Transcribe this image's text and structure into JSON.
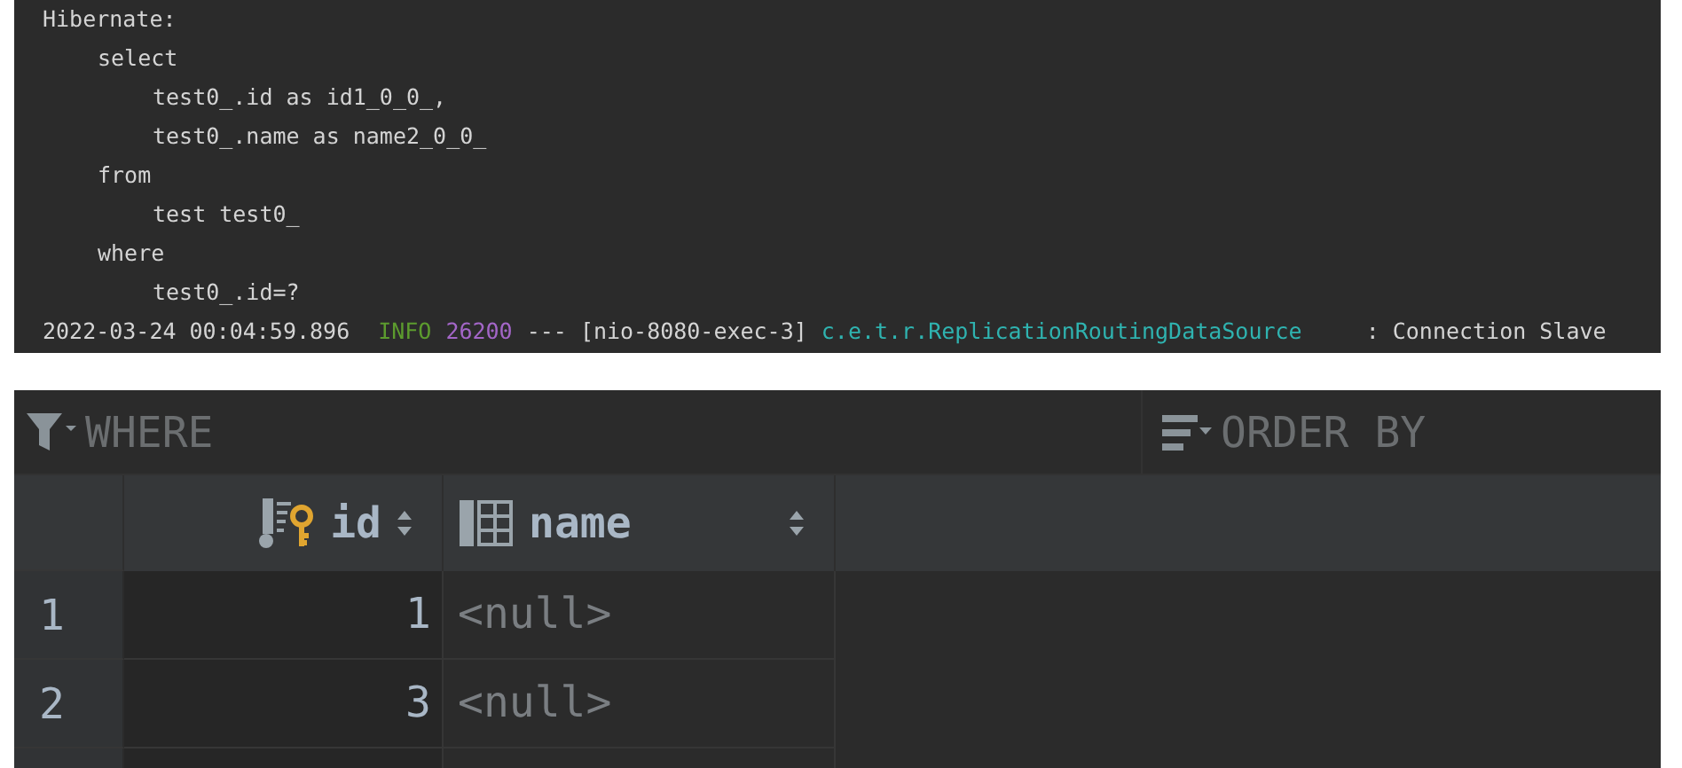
{
  "console": {
    "lines": [
      {
        "text": "Hibernate:",
        "children": [
          {
            "text": "select",
            "children": [
              {
                "text": "test0_.id as id1_0_0_,"
              },
              {
                "text": "test0_.name as name2_0_0_"
              }
            ]
          },
          {
            "text": "from",
            "children": [
              {
                "text": "test test0_"
              }
            ]
          },
          {
            "text": "where",
            "children": [
              {
                "text": "test0_.id=?"
              }
            ]
          }
        ]
      }
    ],
    "log_line": [
      {
        "kind": "timestamp",
        "text": "2022-03-24 00:04:59.896"
      },
      {
        "kind": "level",
        "text": "INFO"
      },
      {
        "kind": "pid",
        "text": "26200"
      },
      {
        "kind": "plain",
        "text": "--- [nio-8080-exec-3]"
      },
      {
        "kind": "logger",
        "text": "c.e.t.r.ReplicationRoutingDataSource"
      },
      {
        "kind": "plain",
        "text": ": Connection Slave"
      }
    ]
  },
  "data_grid": {
    "filter": {
      "placeholder": "WHERE"
    },
    "order": {
      "placeholder": "ORDER BY"
    },
    "columns": [
      {
        "name": "id",
        "kind": "primary_key"
      },
      {
        "name": "name",
        "kind": "column"
      }
    ],
    "rows": [
      {
        "number": "1",
        "cells": [
          {
            "text": "1",
            "kind": "number"
          },
          {
            "text": "<null>",
            "kind": "null"
          }
        ]
      },
      {
        "number": "2",
        "cells": [
          {
            "text": "3",
            "kind": "number"
          },
          {
            "text": "<null>",
            "kind": "null"
          }
        ]
      }
    ]
  }
}
